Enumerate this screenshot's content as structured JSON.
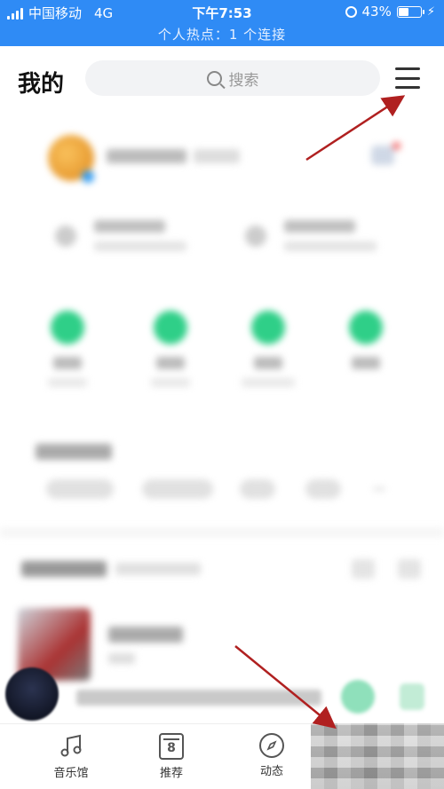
{
  "status_bar": {
    "carrier": "中国移动",
    "network": "4G",
    "time": "下午7:53",
    "battery_percent_text": "43%",
    "battery_level": 0.43,
    "hotspot": "个人热点：1 个连接"
  },
  "header": {
    "title": "我的",
    "search_placeholder": "搜索"
  },
  "bottom_nav": {
    "items": [
      {
        "label": "音乐馆",
        "icon": "music-note-icon"
      },
      {
        "label": "推荐",
        "icon": "calendar-icon",
        "badge": "8"
      },
      {
        "label": "动态",
        "icon": "compass-icon"
      }
    ]
  },
  "colors": {
    "status_bar_bg": "#2f8bf5",
    "accent_green": "#2fcf88",
    "annotation_arrow": "#b02020"
  }
}
